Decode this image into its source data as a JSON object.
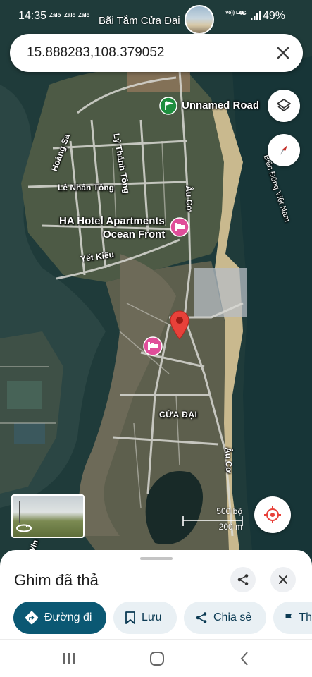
{
  "status": {
    "time": "14:35",
    "notifications": [
      "Zalo",
      "Zalo",
      "Zalo"
    ],
    "place": "Bãi Tắm Cửa Đại",
    "signal": "Vo)) LTE",
    "network": "4G",
    "battery": "49%"
  },
  "search": {
    "query": "15.888283,108.379052"
  },
  "map": {
    "labels": {
      "unnamed_road": "Unnamed Road",
      "hoang_sa": "Hoàng Sa",
      "ly_thanh_tong": "Lý Thánh Tông",
      "le_nhan_tong": "Lê Nhân Tông",
      "hotel_line1": "HA Hotel Apartments",
      "hotel_line2": "Ocean Front",
      "yet_kieu": "Yết Kiêu",
      "au_co_1": "Âu Cơ",
      "au_co_2": "Âu Cơ",
      "cua_dai": "CỬA ĐẠI",
      "bien_dong": "Biển Đông Việt Nam",
      "vin": "Vin"
    },
    "scale": {
      "imperial": "500 bộ",
      "metric": "200 m"
    },
    "colors": {
      "pin": "#e8413a",
      "hotel_marker": "#e04e9a",
      "park_marker": "#1e8e3e"
    }
  },
  "sheet": {
    "title": "Ghim đã thả",
    "actions": {
      "directions": "Đường đi",
      "save": "Lưu",
      "share": "Chia sẻ",
      "more": "Th"
    }
  },
  "icons": {
    "close": "close-icon",
    "layers": "layers-icon",
    "compass": "compass-icon",
    "locate": "my-location-icon",
    "share": "share-icon",
    "directions": "directions-icon",
    "bookmark": "bookmark-icon",
    "flag": "flag-icon"
  }
}
